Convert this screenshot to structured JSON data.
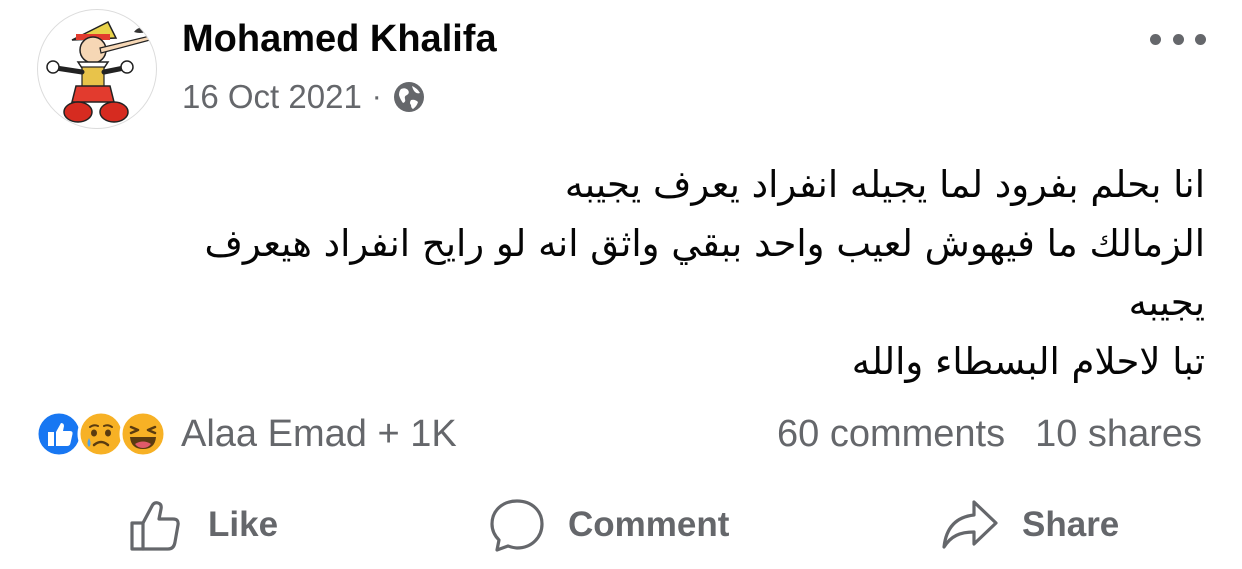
{
  "post": {
    "author": "Mohamed Khalifa",
    "date": "16 Oct 2021",
    "separator": "·",
    "privacy_icon": "globe-icon",
    "avatar": "pinocchio-avatar",
    "more_icon": "more-options-icon",
    "text_lines": [
      "انا بحلم بفرود لما يجيله انفراد يعرف يجيبه",
      "الزمالك ما فيهوش لعيب واحد ببقي واثق انه لو رايح انفراد هيعرف",
      "يجيبه",
      "تبا لاحلام البسطاء والله"
    ]
  },
  "engagement": {
    "reaction_icons": [
      "like-icon",
      "sad-icon",
      "haha-icon"
    ],
    "reactors": "Alaa Emad + 1K",
    "comments": "60 comments",
    "shares": "10 shares"
  },
  "actions": {
    "like": "Like",
    "comment": "Comment",
    "share": "Share"
  },
  "colors": {
    "text": "#050505",
    "secondary": "#65676b",
    "like_blue": "#1877f2",
    "emoji_yellow": "#f7b125"
  }
}
